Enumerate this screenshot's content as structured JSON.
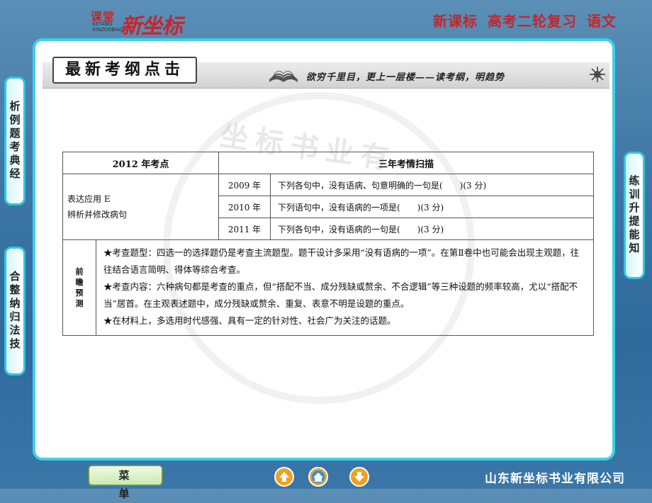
{
  "header": {
    "logo_small": "课堂",
    "logo_pinyin_1": "KETANG",
    "logo_pinyin_2": "XINZUOBIAO",
    "logo_big": "新坐标",
    "title_1": "新课标",
    "title_2": "高考二轮复习",
    "title_3": "语文"
  },
  "banner": {
    "title": "最新考纲点击",
    "slogan": "欲穷千里目，更上一层楼——读考纲，明趋势"
  },
  "watermark_text": "坐标书业有",
  "table": {
    "header_left": "2012 年考点",
    "header_right": "三年考情扫描",
    "topic_line1": "表达应用 E",
    "topic_line2": "辨析并修改病句",
    "rows": [
      {
        "year": "2009 年",
        "question": "下列各句中，没有语病、句意明确的一句是(　　)(3 分)"
      },
      {
        "year": "2010 年",
        "question": "下列语句中，没有语病的一项是(　　)(3 分)"
      },
      {
        "year": "2011 年",
        "question": "下列各句中，没有语病的一句是(　　)(3 分)"
      }
    ],
    "prediction_label": "前瞻预测",
    "predictions": [
      "★考查题型：四选一的选择题仍是考查主流题型。题干设计多采用“没有语病的一项”。在第Ⅱ卷中也可能会出现主观题，往往结合语言简明、得体等综合考查。",
      "★考查内容：六种病句都是考查的重点，但“搭配不当、成分残缺或赘余、不合逻辑”等三种设题的频率较高，尤以“搭配不当”居首。在主观表述题中，成分残缺或赘余、重复、表意不明是设题的重点。",
      "★在材料上，多选用时代感强、具有一定的针对性、社会广为关注的话题。"
    ]
  },
  "side_tabs": {
    "left_1": "析例题考典经",
    "left_2": "合整纳归法技",
    "right_1": "练训升提能知"
  },
  "footer": {
    "menu_label": "菜单",
    "company": "山东新坐标书业有限公司"
  }
}
